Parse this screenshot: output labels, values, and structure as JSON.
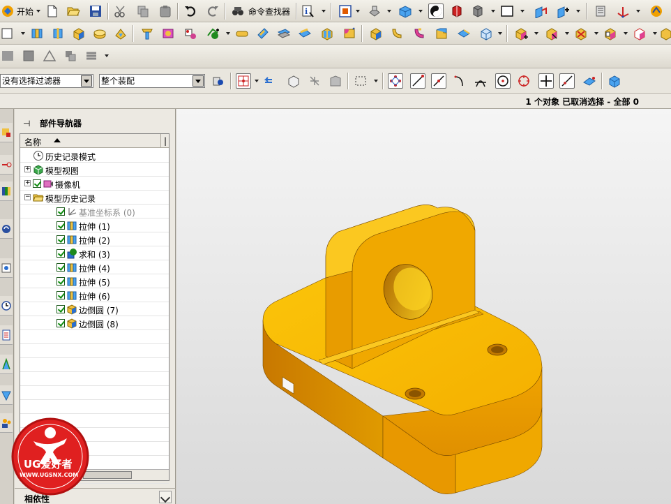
{
  "toolbar1": {
    "start_label": "开始",
    "cmd_finder_label": "命令查找器",
    "buttons": [
      "start-menu",
      "new-file",
      "open-file",
      "save",
      "cut",
      "copy",
      "paste",
      "undo",
      "redo",
      "command-finder",
      "info",
      "fit-view",
      "render-style",
      "view-orientation",
      "shaded",
      "edge-display",
      "face-display",
      "display-style",
      "layout",
      "work-layer",
      "wcs",
      "show-hide"
    ]
  },
  "toolbar2": {
    "buttons": [
      "sketch",
      "extrude",
      "revolve",
      "block",
      "cylinder",
      "cone",
      "sphere",
      "hole",
      "boss",
      "pocket",
      "pad",
      "slot",
      "groove",
      "edge-blend",
      "chamfer",
      "shell",
      "trim-body",
      "unite",
      "subtract",
      "intersect",
      "instance",
      "mirror",
      "pattern",
      "offset-face",
      "scale"
    ]
  },
  "selection_bar": {
    "filter_value": "没有选择过滤器",
    "scope_value": "整个装配"
  },
  "status": {
    "text": "1 个对象 已取消选择  - 全部 0"
  },
  "navigator": {
    "title": "部件导航器",
    "column_name": "名称",
    "column_next": "|",
    "tree": [
      {
        "label": "历史记录模式",
        "indent": 0,
        "expander": "",
        "icon": "clock-icon",
        "check": false,
        "grey": false
      },
      {
        "label": "模型视图",
        "indent": 0,
        "expander": "+",
        "icon": "model-view-icon",
        "check": false,
        "grey": false
      },
      {
        "label": "摄像机",
        "indent": 0,
        "expander": "+",
        "icon": "camera-icon",
        "check": true,
        "grey": false
      },
      {
        "label": "模型历史记录",
        "indent": 0,
        "expander": "-",
        "icon": "folder-icon",
        "check": false,
        "grey": false
      },
      {
        "label": "基准坐标系 (0)",
        "indent": 1,
        "expander": "",
        "icon": "datum-csys-icon",
        "check": true,
        "grey": true
      },
      {
        "label": "拉伸 (1)",
        "indent": 1,
        "expander": "",
        "icon": "extrude-icon",
        "check": true,
        "grey": false
      },
      {
        "label": "拉伸 (2)",
        "indent": 1,
        "expander": "",
        "icon": "extrude-icon",
        "check": true,
        "grey": false
      },
      {
        "label": "求和 (3)",
        "indent": 1,
        "expander": "",
        "icon": "unite-icon",
        "check": true,
        "grey": false
      },
      {
        "label": "拉伸 (4)",
        "indent": 1,
        "expander": "",
        "icon": "extrude-icon",
        "check": true,
        "grey": false
      },
      {
        "label": "拉伸 (5)",
        "indent": 1,
        "expander": "",
        "icon": "extrude-icon",
        "check": true,
        "grey": false
      },
      {
        "label": "拉伸 (6)",
        "indent": 1,
        "expander": "",
        "icon": "extrude-icon",
        "check": true,
        "grey": false
      },
      {
        "label": "边倒圆 (7)",
        "indent": 1,
        "expander": "",
        "icon": "edge-blend-icon",
        "check": true,
        "grey": false
      },
      {
        "label": "边倒圆 (8)",
        "indent": 1,
        "expander": "",
        "icon": "edge-blend-icon",
        "check": true,
        "grey": false
      }
    ],
    "dependency_label": "相依性"
  },
  "watermark": {
    "brand": "UG爱好者",
    "url": "WWW.UGSNX.COM"
  },
  "colors": {
    "part_face": "#f5b400",
    "part_side": "#d88a00",
    "part_top": "#fcc810",
    "toolbar_bg": "#e9e6de",
    "watermark_red": "#e02020"
  }
}
